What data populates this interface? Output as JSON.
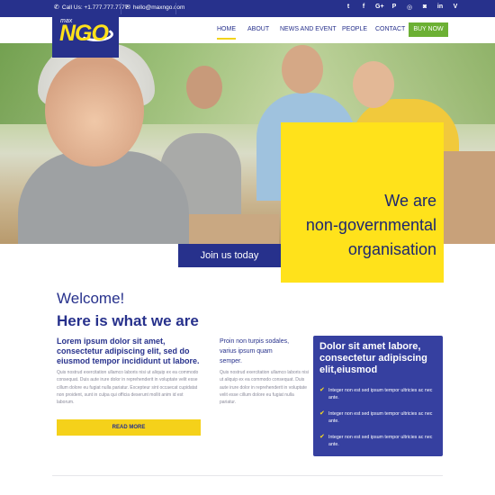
{
  "topbar": {
    "phone": "Call Us: +1.777.777.7777",
    "email": "hello@maxngo.com",
    "social": [
      "twitter-icon",
      "facebook-icon",
      "google-plus-icon",
      "pinterest-icon",
      "dribbble-icon",
      "instagram-icon",
      "linkedin-icon",
      "vimeo-icon"
    ],
    "social_glyphs": [
      "t",
      "f",
      "G+",
      "P",
      "◎",
      "◙",
      "in",
      "V"
    ]
  },
  "logo": {
    "small": "max",
    "main": "NGO"
  },
  "nav": {
    "items": [
      "HOME",
      "ABOUT",
      "NEWS AND EVENT",
      "PEOPLE",
      "CONTACT"
    ],
    "active": "HOME",
    "cta": "BUY NOW"
  },
  "hero": {
    "line1": "We are",
    "line2": "non-governmental",
    "line3": "organisation",
    "join": "Join us today"
  },
  "intro": {
    "welcome": "Welcome!",
    "heading": "Here is what we are",
    "lead": "Lorem ipsum dolor sit amet, consectetur adipiscing elit, sed do eiusmod tempor incididunt ut labore.",
    "body": "Quis nostrud exercitation ullamco laboris nisi ut aliquip ex ea commodo consequat. Duis aute irure dolor in reprehenderit in voluptate velit esse cillum dolore eu fugiat nulla pariatur. Excepteur sint occaecat cupidatat non proident, sunt in culpa qui officia deserunt mollit anim id est laborum.",
    "read_more": "READ MORE"
  },
  "col2": {
    "head": "Proin non turpis sodales, varius ipsum quam semper.",
    "body": "Quis nostrud exercitation ullamco laboris nisi ut aliquip ex ea commodo consequat. Duis aute irure dolor in reprehenderit in voluptate velit esse cillum dolore eu fugiat nulla pariatur."
  },
  "panel": {
    "heading": "Dolor sit amet labore, consectetur adipiscing elit,eiusmod",
    "items": [
      "Integer non est sed ipsum tempor ultricies ac nec ante.",
      "Integer non est sed ipsum tempor ultricies ac nec ante.",
      "Integer non est sed ipsum tempor ultricies ac nec ante."
    ]
  },
  "colors": {
    "brand_blue": "#27318c",
    "brand_yellow": "#ffe21b",
    "cta_green": "#6cb034"
  }
}
